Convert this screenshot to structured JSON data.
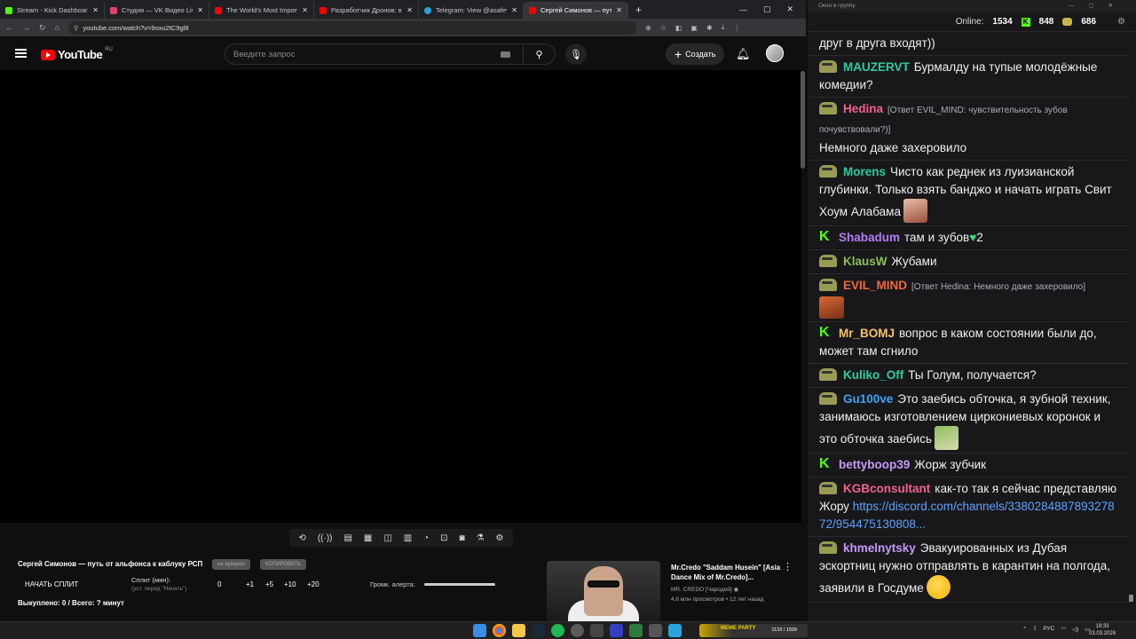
{
  "browser": {
    "tabs": [
      {
        "title": "Stream - Kick Dashboard",
        "color": "#53fc18"
      },
      {
        "title": "Студия — VK Видео Live",
        "color": "#e0436b"
      },
      {
        "title": "The World's Most Important M",
        "color": "#ff0000"
      },
      {
        "title": "Разработчик Дронов: вся",
        "color": "#ff0000"
      },
      {
        "title": "Telegram: View @asafevitas",
        "color": "#2aa3db"
      },
      {
        "title": "Сергей Симонов — путь от ал",
        "color": "#ff0000"
      }
    ],
    "url": "youtube.com/watch?v=9oxu2tC9gl8"
  },
  "youtube": {
    "logo_text": "YouTube",
    "region": "RU",
    "search_placeholder": "Введите запрос",
    "create_label": "Создать"
  },
  "controls": {
    "video_title": "Сергей Симонов — путь от альфонса к каблуку РСП",
    "pill_auction": "на аукцион",
    "pill_copy": "КОПИРОВАТЬ",
    "start_split": "НАЧАТЬ СПЛИТ",
    "split_label": "Сплит (мин):",
    "split_hint": "(уст. перед \"Начать\")",
    "split_values": [
      "0",
      "+1",
      "+5",
      "+10",
      "+20"
    ],
    "alert_volume_label": "Громк. алерта:",
    "killed": "Выкуплено: 0 / Всего: ? минут"
  },
  "recommendation": {
    "title": "Mr.Credo \"Saddam Husein\" [Asia Dance Mix of Mr.Credo]...",
    "channel": "MR. CREDO [Чародей]",
    "meta": "4,6 млн просмотров • 12 лет назад"
  },
  "chat_window": {
    "window_title": "Окно в группу",
    "online_label": "Online:",
    "online_count": "1534",
    "kick_count": "848",
    "gold_count": "686"
  },
  "chat": [
    {
      "user": "",
      "color": "#efeff1",
      "badge": "none",
      "reply": "",
      "text": "друг в друга входят))"
    },
    {
      "user": "MAUZERVT",
      "color": "#2ecc9a",
      "badge": "pepe",
      "reply": "",
      "text": "Бурмалду на тупые молодёжные комедии?"
    },
    {
      "user": "Hedina",
      "color": "#f2618a",
      "badge": "pepe",
      "reply": "[Ответ EVIL_MIND: чувствительность зубов почувствовали?)]",
      "text": "Немного даже захеровило"
    },
    {
      "user": "Morens",
      "color": "#2ecc9a",
      "badge": "pepe",
      "reply": "",
      "text": "Чисто как реднек из луизианской глубинки. Только взять банджо и начать играть Свит Хоум Алабама"
    },
    {
      "user": "Shabadum",
      "color": "#b37cf2",
      "badge": "kick",
      "reply": "",
      "text": "там и зубов",
      "tail": "2"
    },
    {
      "user": "KlausW",
      "color": "#8fbf5c",
      "badge": "pepe",
      "reply": "",
      "text": "Жубами"
    },
    {
      "user": "EVIL_MIND",
      "color": "#ef6a3a",
      "badge": "pepe",
      "reply": "[Ответ Hedina: Немного даже захеровило]",
      "text": ""
    },
    {
      "user": "Mr_BOMJ",
      "color": "#f5c26b",
      "badge": "kick",
      "reply": "",
      "text": "вопрос в каком состоянии были до, может там сгнило"
    },
    {
      "user": "Kuliko_Off",
      "color": "#2ecc9a",
      "badge": "pepe",
      "reply": "",
      "text": "Ты Голум, получается?"
    },
    {
      "user": "Gu100ve",
      "color": "#3da2f0",
      "badge": "pepe",
      "reply": "",
      "text": "Это заебись обточка, я зубной техник, занимаюсь изготовлением циркониевых коронок и это обточка заебись"
    },
    {
      "user": "bettyboop39",
      "color": "#c59af5",
      "badge": "kick",
      "reply": "",
      "text": "Жорж зубчик"
    },
    {
      "user": "KGBconsultant",
      "color": "#f2618a",
      "badge": "pepe",
      "reply": "",
      "text": "как-то так я сейчас представляю Жору",
      "link": "https://discord.com/channels/338028488789327872/954475130808..."
    },
    {
      "user": "khmelnytsky",
      "color": "#c59af5",
      "badge": "pepe",
      "reply": "",
      "text": "Эвакуированных из Дубая эскортниц нужно отправлять в карантин на полгода, заявили в Госдуме"
    }
  ],
  "taskbar": {
    "widget_label": "MEME PARTY",
    "widget_value": "1133 / 1599",
    "lang": "РУС",
    "time": "19:33",
    "date": "03.03.2026"
  }
}
